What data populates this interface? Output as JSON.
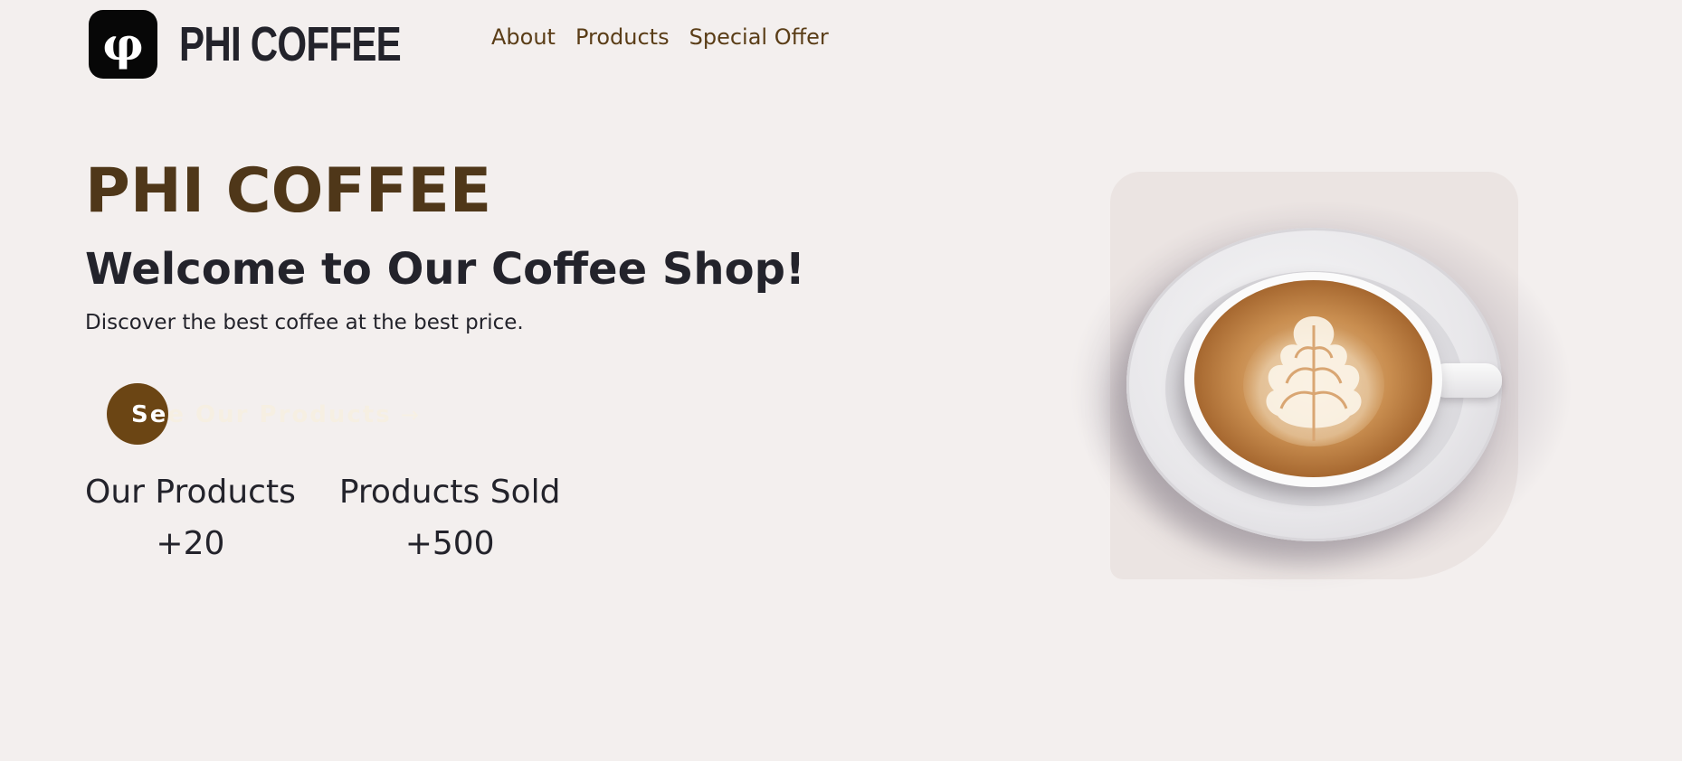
{
  "header": {
    "logo_glyph": "φ",
    "brand": "PHI COFFEE",
    "nav": [
      {
        "label": "About"
      },
      {
        "label": "Products"
      },
      {
        "label": "Special Offer"
      }
    ]
  },
  "hero": {
    "title": "PHI COFFEE",
    "subtitle": "Welcome to Our Coffee Shop!",
    "description": "Discover the best coffee at the best price.",
    "cta_label": "See Our Products",
    "cta_arrow": "→"
  },
  "stats": [
    {
      "label": "Our Products",
      "value": "+20"
    },
    {
      "label": "Products Sold",
      "value": "+500"
    }
  ],
  "colors": {
    "background": "#f3efee",
    "accent_brown": "#6b4514",
    "title_brown": "#4f3719",
    "text_dark": "#23232b",
    "card_bg": "#ebe4e2"
  },
  "icons": {
    "logo": "phi-logo-icon",
    "cta_arrow": "arrow-right-icon"
  }
}
